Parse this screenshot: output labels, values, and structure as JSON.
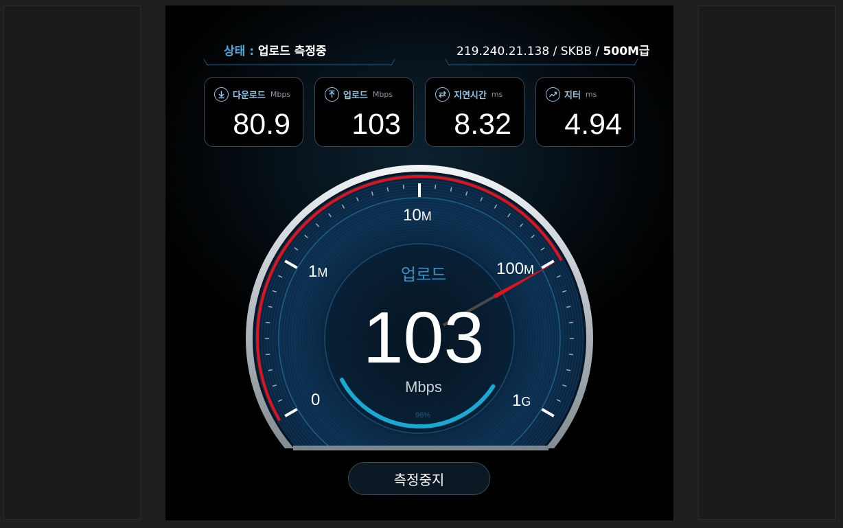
{
  "status": {
    "key_label": "상태 :",
    "value": "업로드 측정중"
  },
  "connection": {
    "ip_isp": "219.240.21.138 / SKBB /",
    "plan": "500M급"
  },
  "metrics": {
    "download": {
      "label": "다운로드",
      "unit": "Mbps",
      "value": "80.9",
      "icon": "download-arrow-icon"
    },
    "upload": {
      "label": "업로드",
      "unit": "Mbps",
      "value": "103",
      "icon": "upload-arrow-icon"
    },
    "latency": {
      "label": "지연시간",
      "unit": "ms",
      "value": "8.32",
      "icon": "swap-arrows-icon"
    },
    "jitter": {
      "label": "지터",
      "unit": "ms",
      "value": "4.94",
      "icon": "trend-line-icon"
    }
  },
  "gauge": {
    "scale_labels": {
      "zero": "0",
      "one_m": "1",
      "one_m_suffix": "M",
      "ten_m": "10",
      "ten_m_suffix": "M",
      "hundred_m": "100",
      "hundred_m_suffix": "M",
      "one_g": "1",
      "one_g_suffix": "G"
    },
    "mode_label": "업로드",
    "speed_value": "103",
    "speed_unit": "Mbps",
    "progress_percent_text": "96%",
    "progress_fraction": 0.96,
    "needle_speed_mbps": 103,
    "colors": {
      "arc_red": "#e0121b",
      "progress_cyan": "#19a9d2",
      "accent_blue": "#4fa7d8"
    }
  },
  "stop_button_label": "측정중지"
}
